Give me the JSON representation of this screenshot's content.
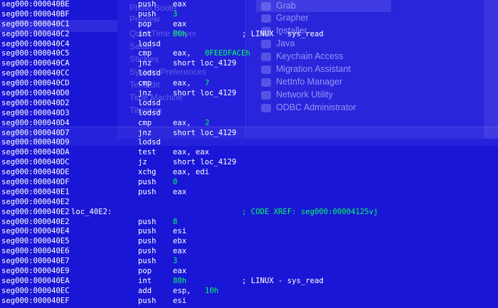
{
  "background": {
    "finder_sidebar": [
      "Photo Booth",
      "Preview",
      "QuickTime Player",
      "Safari",
      "Stickies",
      "System Preferences",
      "TextEdit",
      "Time Machine",
      "Titanium"
    ],
    "utilities": [
      "Grab",
      "Grapher",
      "Installer",
      "Java",
      "Keychain Access",
      "Migration Assistant",
      "NetInfo Manager",
      "Network Utility",
      "ODBC Administrator"
    ]
  },
  "colors": {
    "background": "#1a16d6",
    "text": "#ffffff",
    "number": "#00ff60",
    "comment": "#00ff60"
  },
  "listing": [
    {
      "addr": "seg000:000040BE",
      "mnem": "push",
      "op1": "eax"
    },
    {
      "addr": "seg000:000040BF",
      "mnem": "push",
      "op1_num": "3"
    },
    {
      "addr": "seg000:000040C1",
      "mnem": "pop",
      "op1": "eax"
    },
    {
      "addr": "seg000:000040C2",
      "mnem": "int",
      "op1_num": "80h",
      "comment": "; LINUX - sys_read"
    },
    {
      "addr": "seg000:000040C4",
      "mnem": "lodsd"
    },
    {
      "addr": "seg000:000040C5",
      "mnem": "cmp",
      "op1": "eax,",
      "op2_num": "0FEEDFACEh"
    },
    {
      "addr": "seg000:000040CA",
      "mnem": "jnz",
      "op1": "short loc_4129"
    },
    {
      "addr": "seg000:000040CC",
      "mnem": "lodsd"
    },
    {
      "addr": "seg000:000040CD",
      "mnem": "cmp",
      "op1": "eax,",
      "op2_num": "7"
    },
    {
      "addr": "seg000:000040D0",
      "mnem": "jnz",
      "op1": "short loc_4129"
    },
    {
      "addr": "seg000:000040D2",
      "mnem": "lodsd"
    },
    {
      "addr": "seg000:000040D3",
      "mnem": "lodsd"
    },
    {
      "addr": "seg000:000040D4",
      "mnem": "cmp",
      "op1": "eax,",
      "op2_num": "2"
    },
    {
      "addr": "seg000:000040D7",
      "mnem": "jnz",
      "op1": "short loc_4129"
    },
    {
      "addr": "seg000:000040D9",
      "mnem": "lodsd"
    },
    {
      "addr": "seg000:000040DA",
      "mnem": "test",
      "op1": "eax, eax"
    },
    {
      "addr": "seg000:000040DC",
      "mnem": "jz",
      "op1": "short loc_4129"
    },
    {
      "addr": "seg000:000040DE",
      "mnem": "xchg",
      "op1": "eax, edi"
    },
    {
      "addr": "seg000:000040DF",
      "mnem": "push",
      "op1_num": "0"
    },
    {
      "addr": "seg000:000040E1",
      "mnem": "push",
      "op1": "eax"
    },
    {
      "addr": "seg000:000040E2"
    },
    {
      "addr": "seg000:000040E2",
      "label": "loc_40E2:",
      "xref": "; CODE XREF: seg000:00004125vj"
    },
    {
      "addr": "seg000:000040E2",
      "mnem": "push",
      "op1_num": "8"
    },
    {
      "addr": "seg000:000040E4",
      "mnem": "push",
      "op1": "esi"
    },
    {
      "addr": "seg000:000040E5",
      "mnem": "push",
      "op1": "ebx"
    },
    {
      "addr": "seg000:000040E6",
      "mnem": "push",
      "op1": "eax"
    },
    {
      "addr": "seg000:000040E7",
      "mnem": "push",
      "op1_num": "3"
    },
    {
      "addr": "seg000:000040E9",
      "mnem": "pop",
      "op1": "eax"
    },
    {
      "addr": "seg000:000040EA",
      "mnem": "int",
      "op1_num": "80h",
      "comment": "; LINUX - sys_read"
    },
    {
      "addr": "seg000:000040EC",
      "mnem": "add",
      "op1": "esp,",
      "op2_num": "10h"
    },
    {
      "addr": "seg000:000040EF",
      "mnem": "push",
      "op1": "esi"
    }
  ]
}
